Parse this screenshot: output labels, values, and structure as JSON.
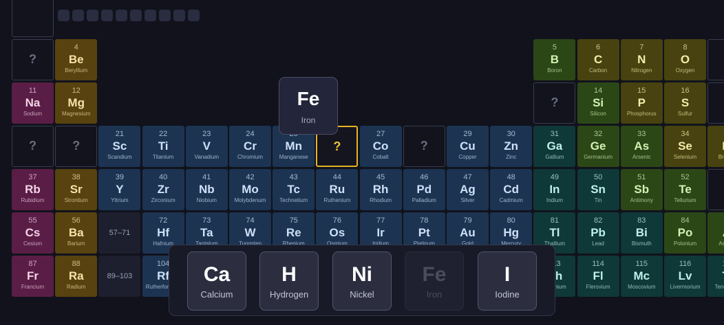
{
  "nav": {
    "back_icon": "arrow-left-icon"
  },
  "progress": {
    "total_segments": 10
  },
  "colors": {
    "target_border": "#e7b422"
  },
  "table": {
    "cells": [
      {
        "kind": "partial",
        "cat": "unk",
        "row": 0,
        "col": 0
      },
      {
        "kind": "unknown",
        "row": 1,
        "col": 0
      },
      {
        "kind": "element",
        "cat": "alkaline",
        "row": 1,
        "col": 1,
        "num": "4",
        "sym": "Be",
        "name": "Beryllium"
      },
      {
        "kind": "element",
        "cat": "metalloid",
        "row": 1,
        "col": 12,
        "num": "5",
        "sym": "B",
        "name": "Boron"
      },
      {
        "kind": "element",
        "cat": "nonmetal",
        "row": 1,
        "col": 13,
        "num": "6",
        "sym": "C",
        "name": "Carbon"
      },
      {
        "kind": "element",
        "cat": "nonmetal",
        "row": 1,
        "col": 14,
        "num": "7",
        "sym": "N",
        "name": "Nitrogen"
      },
      {
        "kind": "element",
        "cat": "nonmetal",
        "row": 1,
        "col": 15,
        "num": "8",
        "sym": "O",
        "name": "Oxygen"
      },
      {
        "kind": "partial",
        "cat": "unk",
        "row": 1,
        "col": 16
      },
      {
        "kind": "element",
        "cat": "alkali",
        "row": 2,
        "col": 0,
        "num": "11",
        "sym": "Na",
        "name": "Sodium"
      },
      {
        "kind": "element",
        "cat": "alkaline",
        "row": 2,
        "col": 1,
        "num": "12",
        "sym": "Mg",
        "name": "Magnesium"
      },
      {
        "kind": "unknown",
        "row": 2,
        "col": 12
      },
      {
        "kind": "element",
        "cat": "metalloid",
        "row": 2,
        "col": 13,
        "num": "14",
        "sym": "Si",
        "name": "Silicon"
      },
      {
        "kind": "element",
        "cat": "nonmetal",
        "row": 2,
        "col": 14,
        "num": "15",
        "sym": "P",
        "name": "Phosphorus"
      },
      {
        "kind": "element",
        "cat": "nonmetal",
        "row": 2,
        "col": 15,
        "num": "16",
        "sym": "S",
        "name": "Sulfur"
      },
      {
        "kind": "partial",
        "cat": "unk",
        "row": 2,
        "col": 16
      },
      {
        "kind": "unknown",
        "row": 3,
        "col": 0
      },
      {
        "kind": "unknown",
        "row": 3,
        "col": 1
      },
      {
        "kind": "element",
        "cat": "trans",
        "row": 3,
        "col": 2,
        "num": "21",
        "sym": "Sc",
        "name": "Scandium"
      },
      {
        "kind": "element",
        "cat": "trans",
        "row": 3,
        "col": 3,
        "num": "22",
        "sym": "Ti",
        "name": "Titanium"
      },
      {
        "kind": "element",
        "cat": "trans",
        "row": 3,
        "col": 4,
        "num": "23",
        "sym": "V",
        "name": "Vanadium"
      },
      {
        "kind": "element",
        "cat": "trans",
        "row": 3,
        "col": 5,
        "num": "24",
        "sym": "Cr",
        "name": "Chromium"
      },
      {
        "kind": "element",
        "cat": "trans",
        "row": 3,
        "col": 6,
        "num": "25",
        "sym": "Mn",
        "name": "Manganese"
      },
      {
        "kind": "target",
        "row": 3,
        "col": 7
      },
      {
        "kind": "element",
        "cat": "trans",
        "row": 3,
        "col": 8,
        "num": "27",
        "sym": "Co",
        "name": "Cobalt"
      },
      {
        "kind": "unknown",
        "row": 3,
        "col": 9
      },
      {
        "kind": "element",
        "cat": "trans",
        "row": 3,
        "col": 10,
        "num": "29",
        "sym": "Cu",
        "name": "Copper"
      },
      {
        "kind": "element",
        "cat": "trans",
        "row": 3,
        "col": 11,
        "num": "30",
        "sym": "Zn",
        "name": "Zinc"
      },
      {
        "kind": "element",
        "cat": "post",
        "row": 3,
        "col": 12,
        "num": "31",
        "sym": "Ga",
        "name": "Gallium"
      },
      {
        "kind": "element",
        "cat": "metalloid",
        "row": 3,
        "col": 13,
        "num": "32",
        "sym": "Ge",
        "name": "Germanium"
      },
      {
        "kind": "element",
        "cat": "metalloid",
        "row": 3,
        "col": 14,
        "num": "33",
        "sym": "As",
        "name": "Arsenic"
      },
      {
        "kind": "element",
        "cat": "nonmetal",
        "row": 3,
        "col": 15,
        "num": "34",
        "sym": "Se",
        "name": "Selenium"
      },
      {
        "kind": "element",
        "cat": "nonmetal",
        "row": 3,
        "col": 16,
        "num": "35",
        "sym": "Br",
        "name": "Bromine"
      },
      {
        "kind": "element",
        "cat": "alkali",
        "row": 4,
        "col": 0,
        "num": "37",
        "sym": "Rb",
        "name": "Rubidium"
      },
      {
        "kind": "element",
        "cat": "alkaline",
        "row": 4,
        "col": 1,
        "num": "38",
        "sym": "Sr",
        "name": "Strontium"
      },
      {
        "kind": "element",
        "cat": "trans",
        "row": 4,
        "col": 2,
        "num": "39",
        "sym": "Y",
        "name": "Yttrium"
      },
      {
        "kind": "element",
        "cat": "trans",
        "row": 4,
        "col": 3,
        "num": "40",
        "sym": "Zr",
        "name": "Zirconium"
      },
      {
        "kind": "element",
        "cat": "trans",
        "row": 4,
        "col": 4,
        "num": "41",
        "sym": "Nb",
        "name": "Niobium"
      },
      {
        "kind": "element",
        "cat": "trans",
        "row": 4,
        "col": 5,
        "num": "42",
        "sym": "Mo",
        "name": "Molybdenum"
      },
      {
        "kind": "element",
        "cat": "trans",
        "row": 4,
        "col": 6,
        "num": "43",
        "sym": "Tc",
        "name": "Technetium"
      },
      {
        "kind": "element",
        "cat": "trans",
        "row": 4,
        "col": 7,
        "num": "44",
        "sym": "Ru",
        "name": "Ruthenium"
      },
      {
        "kind": "element",
        "cat": "trans",
        "row": 4,
        "col": 8,
        "num": "45",
        "sym": "Rh",
        "name": "Rhodium"
      },
      {
        "kind": "element",
        "cat": "trans",
        "row": 4,
        "col": 9,
        "num": "46",
        "sym": "Pd",
        "name": "Palladium"
      },
      {
        "kind": "element",
        "cat": "trans",
        "row": 4,
        "col": 10,
        "num": "47",
        "sym": "Ag",
        "name": "Silver"
      },
      {
        "kind": "element",
        "cat": "trans",
        "row": 4,
        "col": 11,
        "num": "48",
        "sym": "Cd",
        "name": "Cadmium"
      },
      {
        "kind": "element",
        "cat": "post",
        "row": 4,
        "col": 12,
        "num": "49",
        "sym": "In",
        "name": "Indium"
      },
      {
        "kind": "element",
        "cat": "post",
        "row": 4,
        "col": 13,
        "num": "50",
        "sym": "Sn",
        "name": "Tin"
      },
      {
        "kind": "element",
        "cat": "metalloid",
        "row": 4,
        "col": 14,
        "num": "51",
        "sym": "Sb",
        "name": "Antimony"
      },
      {
        "kind": "element",
        "cat": "metalloid",
        "row": 4,
        "col": 15,
        "num": "52",
        "sym": "Te",
        "name": "Tellurium"
      },
      {
        "kind": "partial",
        "cat": "unk",
        "row": 4,
        "col": 16
      },
      {
        "kind": "element",
        "cat": "alkali",
        "row": 5,
        "col": 0,
        "num": "55",
        "sym": "Cs",
        "name": "Cesium"
      },
      {
        "kind": "element",
        "cat": "alkaline",
        "row": 5,
        "col": 1,
        "num": "56",
        "sym": "Ba",
        "name": "Barium"
      },
      {
        "kind": "range",
        "row": 5,
        "col": 2,
        "text": "57–71"
      },
      {
        "kind": "element",
        "cat": "trans",
        "row": 5,
        "col": 3,
        "num": "72",
        "sym": "Hf",
        "name": "Hafnium"
      },
      {
        "kind": "element",
        "cat": "trans",
        "row": 5,
        "col": 4,
        "num": "73",
        "sym": "Ta",
        "name": "Tantalum"
      },
      {
        "kind": "element",
        "cat": "trans",
        "row": 5,
        "col": 5,
        "num": "74",
        "sym": "W",
        "name": "Tungsten"
      },
      {
        "kind": "element",
        "cat": "trans",
        "row": 5,
        "col": 6,
        "num": "75",
        "sym": "Re",
        "name": "Rhenium"
      },
      {
        "kind": "element",
        "cat": "trans",
        "row": 5,
        "col": 7,
        "num": "76",
        "sym": "Os",
        "name": "Osmium"
      },
      {
        "kind": "element",
        "cat": "trans",
        "row": 5,
        "col": 8,
        "num": "77",
        "sym": "Ir",
        "name": "Iridium"
      },
      {
        "kind": "element",
        "cat": "trans",
        "row": 5,
        "col": 9,
        "num": "78",
        "sym": "Pt",
        "name": "Platinum"
      },
      {
        "kind": "element",
        "cat": "trans",
        "row": 5,
        "col": 10,
        "num": "79",
        "sym": "Au",
        "name": "Gold"
      },
      {
        "kind": "element",
        "cat": "trans",
        "row": 5,
        "col": 11,
        "num": "80",
        "sym": "Hg",
        "name": "Mercury"
      },
      {
        "kind": "element",
        "cat": "post",
        "row": 5,
        "col": 12,
        "num": "81",
        "sym": "Tl",
        "name": "Thallium"
      },
      {
        "kind": "element",
        "cat": "post",
        "row": 5,
        "col": 13,
        "num": "82",
        "sym": "Pb",
        "name": "Lead"
      },
      {
        "kind": "element",
        "cat": "post",
        "row": 5,
        "col": 14,
        "num": "83",
        "sym": "Bi",
        "name": "Bismuth"
      },
      {
        "kind": "element",
        "cat": "metalloid",
        "row": 5,
        "col": 15,
        "num": "84",
        "sym": "Po",
        "name": "Polonium"
      },
      {
        "kind": "element",
        "cat": "metalloid",
        "row": 5,
        "col": 16,
        "num": "85",
        "sym": "At",
        "name": "Astatine"
      },
      {
        "kind": "element",
        "cat": "alkali",
        "row": 6,
        "col": 0,
        "num": "87",
        "sym": "Fr",
        "name": "Francium"
      },
      {
        "kind": "element",
        "cat": "alkaline",
        "row": 6,
        "col": 1,
        "num": "88",
        "sym": "Ra",
        "name": "Radium"
      },
      {
        "kind": "range",
        "row": 6,
        "col": 2,
        "text": "89–103"
      },
      {
        "kind": "element",
        "cat": "trans",
        "row": 6,
        "col": 3,
        "num": "104",
        "sym": "Rf",
        "name": "Rutherfordium"
      },
      {
        "kind": "element",
        "cat": "post",
        "row": 6,
        "col": 12,
        "num": "113",
        "sym": "Nh",
        "name": "Nihonium"
      },
      {
        "kind": "element",
        "cat": "post",
        "row": 6,
        "col": 13,
        "num": "114",
        "sym": "Fl",
        "name": "Flerovium"
      },
      {
        "kind": "element",
        "cat": "post",
        "row": 6,
        "col": 14,
        "num": "115",
        "sym": "Mc",
        "name": "Moscovium"
      },
      {
        "kind": "element",
        "cat": "post",
        "row": 6,
        "col": 15,
        "num": "116",
        "sym": "Lv",
        "name": "Livermorium"
      },
      {
        "kind": "element",
        "cat": "post",
        "row": 6,
        "col": 16,
        "num": "117",
        "sym": "Ts",
        "name": "Tennessine"
      }
    ]
  },
  "tooltip": {
    "symbol": "Fe",
    "name": "Iron"
  },
  "choices": [
    {
      "symbol": "Ca",
      "name": "Calcium",
      "used": false
    },
    {
      "symbol": "H",
      "name": "Hydrogen",
      "used": false
    },
    {
      "symbol": "Ni",
      "name": "Nickel",
      "used": false
    },
    {
      "symbol": "Fe",
      "name": "Iron",
      "used": true
    },
    {
      "symbol": "I",
      "name": "Iodine",
      "used": false
    }
  ],
  "unknown_mark": "?"
}
